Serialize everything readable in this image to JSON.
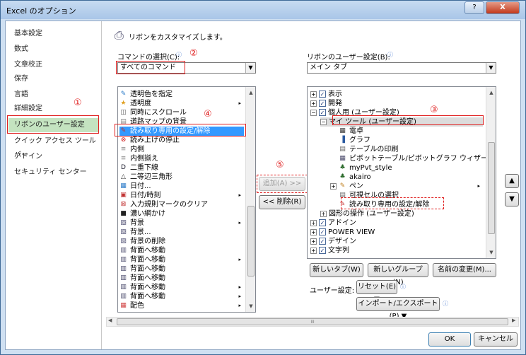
{
  "window": {
    "title": "Excel のオプション",
    "help": "?",
    "close": "X"
  },
  "nav": {
    "items": [
      "基本設定",
      "数式",
      "文章校正",
      "保存",
      "言語",
      "詳細設定",
      "リボンのユーザー設定",
      "クイック アクセス ツール バー",
      "アドイン",
      "セキュリティ センター"
    ]
  },
  "annot": {
    "n1": "①",
    "n2": "②",
    "n3": "③",
    "n4": "④",
    "n5": "⑤"
  },
  "main": {
    "headline": "リボンをカスタマイズします。",
    "cmd_label": "コマンドの選択(C):",
    "cmd_value": "すべてのコマンド",
    "ribbon_label": "リボンのユーザー設定(B):",
    "ribbon_value": "メイン タブ",
    "info": "ⓘ"
  },
  "commands": [
    {
      "t": "透明色を指定",
      "i": "✎",
      "c": "#2a7ac8"
    },
    {
      "t": "透明度",
      "i": "★",
      "c": "#e0a020",
      "sub": true
    },
    {
      "t": "同時にスクロール",
      "i": "◫",
      "c": "#555"
    },
    {
      "t": "道路マップの背景",
      "i": "▤",
      "c": "#888"
    },
    {
      "t": "読み取り専用の設定/解除",
      "i": "✎",
      "c": "#c03030",
      "sel": true
    },
    {
      "t": "読み上げの停止",
      "i": "⊗",
      "c": "#d02020"
    },
    {
      "t": "内側",
      "i": "≡",
      "c": "#888"
    },
    {
      "t": "内側揃え",
      "i": "≡",
      "c": "#888"
    },
    {
      "t": "二重下線",
      "i": "D",
      "c": "#223"
    },
    {
      "t": "二等辺三角形",
      "i": "△",
      "c": "#333"
    },
    {
      "t": "日付...",
      "i": "▦",
      "c": "#2a7ac8"
    },
    {
      "t": "日付/時刻",
      "i": "▣",
      "c": "#c03030",
      "sub": true
    },
    {
      "t": "入力規則マークのクリア",
      "i": "⊠",
      "c": "#c03030"
    },
    {
      "t": "濃い網かけ",
      "i": "■",
      "c": "#222"
    },
    {
      "t": "背景",
      "i": "▧",
      "c": "#557",
      "sub": true
    },
    {
      "t": "背景...",
      "i": "▧",
      "c": "#557"
    },
    {
      "t": "背景の削除",
      "i": "▨",
      "c": "#557"
    },
    {
      "t": "背面へ移動",
      "i": "▥",
      "c": "#446"
    },
    {
      "t": "背面へ移動",
      "i": "▥",
      "c": "#446",
      "sub": true
    },
    {
      "t": "背面へ移動",
      "i": "▥",
      "c": "#446"
    },
    {
      "t": "背面へ移動",
      "i": "▥",
      "c": "#446"
    },
    {
      "t": "背面へ移動",
      "i": "▥",
      "c": "#446",
      "sub": true
    },
    {
      "t": "背面へ移動",
      "i": "▥",
      "c": "#446",
      "sub": true
    },
    {
      "t": "配色",
      "i": "▦",
      "c": "#d04040",
      "sub": true
    }
  ],
  "tree": [
    {
      "t": "表示",
      "lvl": 0,
      "exp": "+",
      "cb": true
    },
    {
      "t": "開発",
      "lvl": 0,
      "exp": "+",
      "cb": true
    },
    {
      "t": "個人用 (ユーザー設定)",
      "lvl": 0,
      "exp": "−",
      "cb": true
    },
    {
      "t": "マイ ツール (ユーザー設定)",
      "lvl": 1,
      "exp": "−",
      "hl": true
    },
    {
      "t": "電卓",
      "lvl": 2,
      "i": "▦",
      "c": "#333"
    },
    {
      "t": "グラフ",
      "lvl": 2,
      "i": "▐",
      "c": "#2a5aa0"
    },
    {
      "t": "テーブルの印刷",
      "lvl": 2,
      "i": "▤",
      "c": "#666"
    },
    {
      "t": "ピボットテーブル/ピボットグラフ ウィザード",
      "lvl": 2,
      "i": "▦",
      "c": "#446"
    },
    {
      "t": "myPvt_style",
      "lvl": 2,
      "i": "♣",
      "c": "#2a6a2a"
    },
    {
      "t": "akairo",
      "lvl": 2,
      "i": "♣",
      "c": "#2a6a2a"
    },
    {
      "t": "ペン",
      "lvl": 2,
      "exp": "+",
      "i": "✎",
      "c": "#c08020",
      "sub": true
    },
    {
      "t": "可視セルの選択",
      "lvl": 2,
      "i": "▤",
      "c": "#666"
    },
    {
      "t": "読み取り専用の設定/解除",
      "lvl": 2,
      "i": "✎",
      "c": "#c03030"
    },
    {
      "t": "図形の操作 (ユーザー設定)",
      "lvl": 1,
      "exp": "+"
    },
    {
      "t": "アドイン",
      "lvl": 0,
      "exp": "+",
      "cb": true
    },
    {
      "t": "POWER VIEW",
      "lvl": 0,
      "exp": "+",
      "cb": true
    },
    {
      "t": "デザイン",
      "lvl": 0,
      "exp": "+",
      "cb": true
    },
    {
      "t": "文字列",
      "lvl": 0,
      "exp": "+",
      "cb": true
    }
  ],
  "buttons": {
    "add": "追加(A) >>",
    "remove": "<< 削除(R)",
    "new_tab": "新しいタブ(W)",
    "new_group": "新しいグループ(N)",
    "rename": "名前の変更(M)...",
    "user_setting": "ユーザー設定:",
    "reset": "リセット(E) ▼",
    "import_export": "インポート/エクスポート(P) ▼",
    "up": "▲",
    "down": "▼",
    "ok": "OK",
    "cancel": "キャンセル"
  },
  "hscroll": {
    "grip": "III"
  }
}
